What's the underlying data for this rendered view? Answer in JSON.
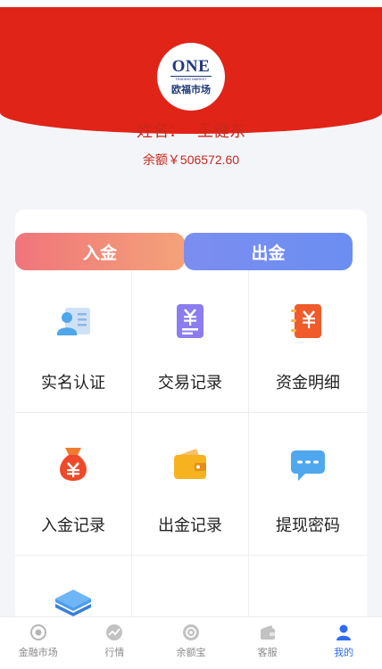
{
  "header": {
    "logo": {
      "main": "ONE",
      "tagline": "TRADING MARKET",
      "sub": "欧福市场"
    },
    "user": {
      "name_label": "姓名：",
      "name": "王健东"
    },
    "balance": "余额￥506572.60"
  },
  "actions": {
    "deposit": "入金",
    "withdraw": "出金"
  },
  "menu": [
    {
      "label": "实名认证",
      "icon": "id-card-icon"
    },
    {
      "label": "交易记录",
      "icon": "receipt-icon"
    },
    {
      "label": "资金明细",
      "icon": "wallet-book-icon"
    },
    {
      "label": "入金记录",
      "icon": "money-bag-icon"
    },
    {
      "label": "出金记录",
      "icon": "wallet-icon"
    },
    {
      "label": "提现密码",
      "icon": "chat-password-icon"
    },
    {
      "label": "",
      "icon": "layers-icon"
    }
  ],
  "tabbar": {
    "items": [
      {
        "label": "金融市场",
        "icon": "market-icon"
      },
      {
        "label": "行情",
        "icon": "trend-icon"
      },
      {
        "label": "余额宝",
        "icon": "balance-treasure-icon"
      },
      {
        "label": "客服",
        "icon": "service-icon"
      },
      {
        "label": "我的",
        "icon": "user-icon"
      }
    ],
    "active_index": 4
  },
  "colors": {
    "brand_red": "#e12418",
    "text_red": "#c8281c",
    "tab_active": "#2f6df0"
  }
}
